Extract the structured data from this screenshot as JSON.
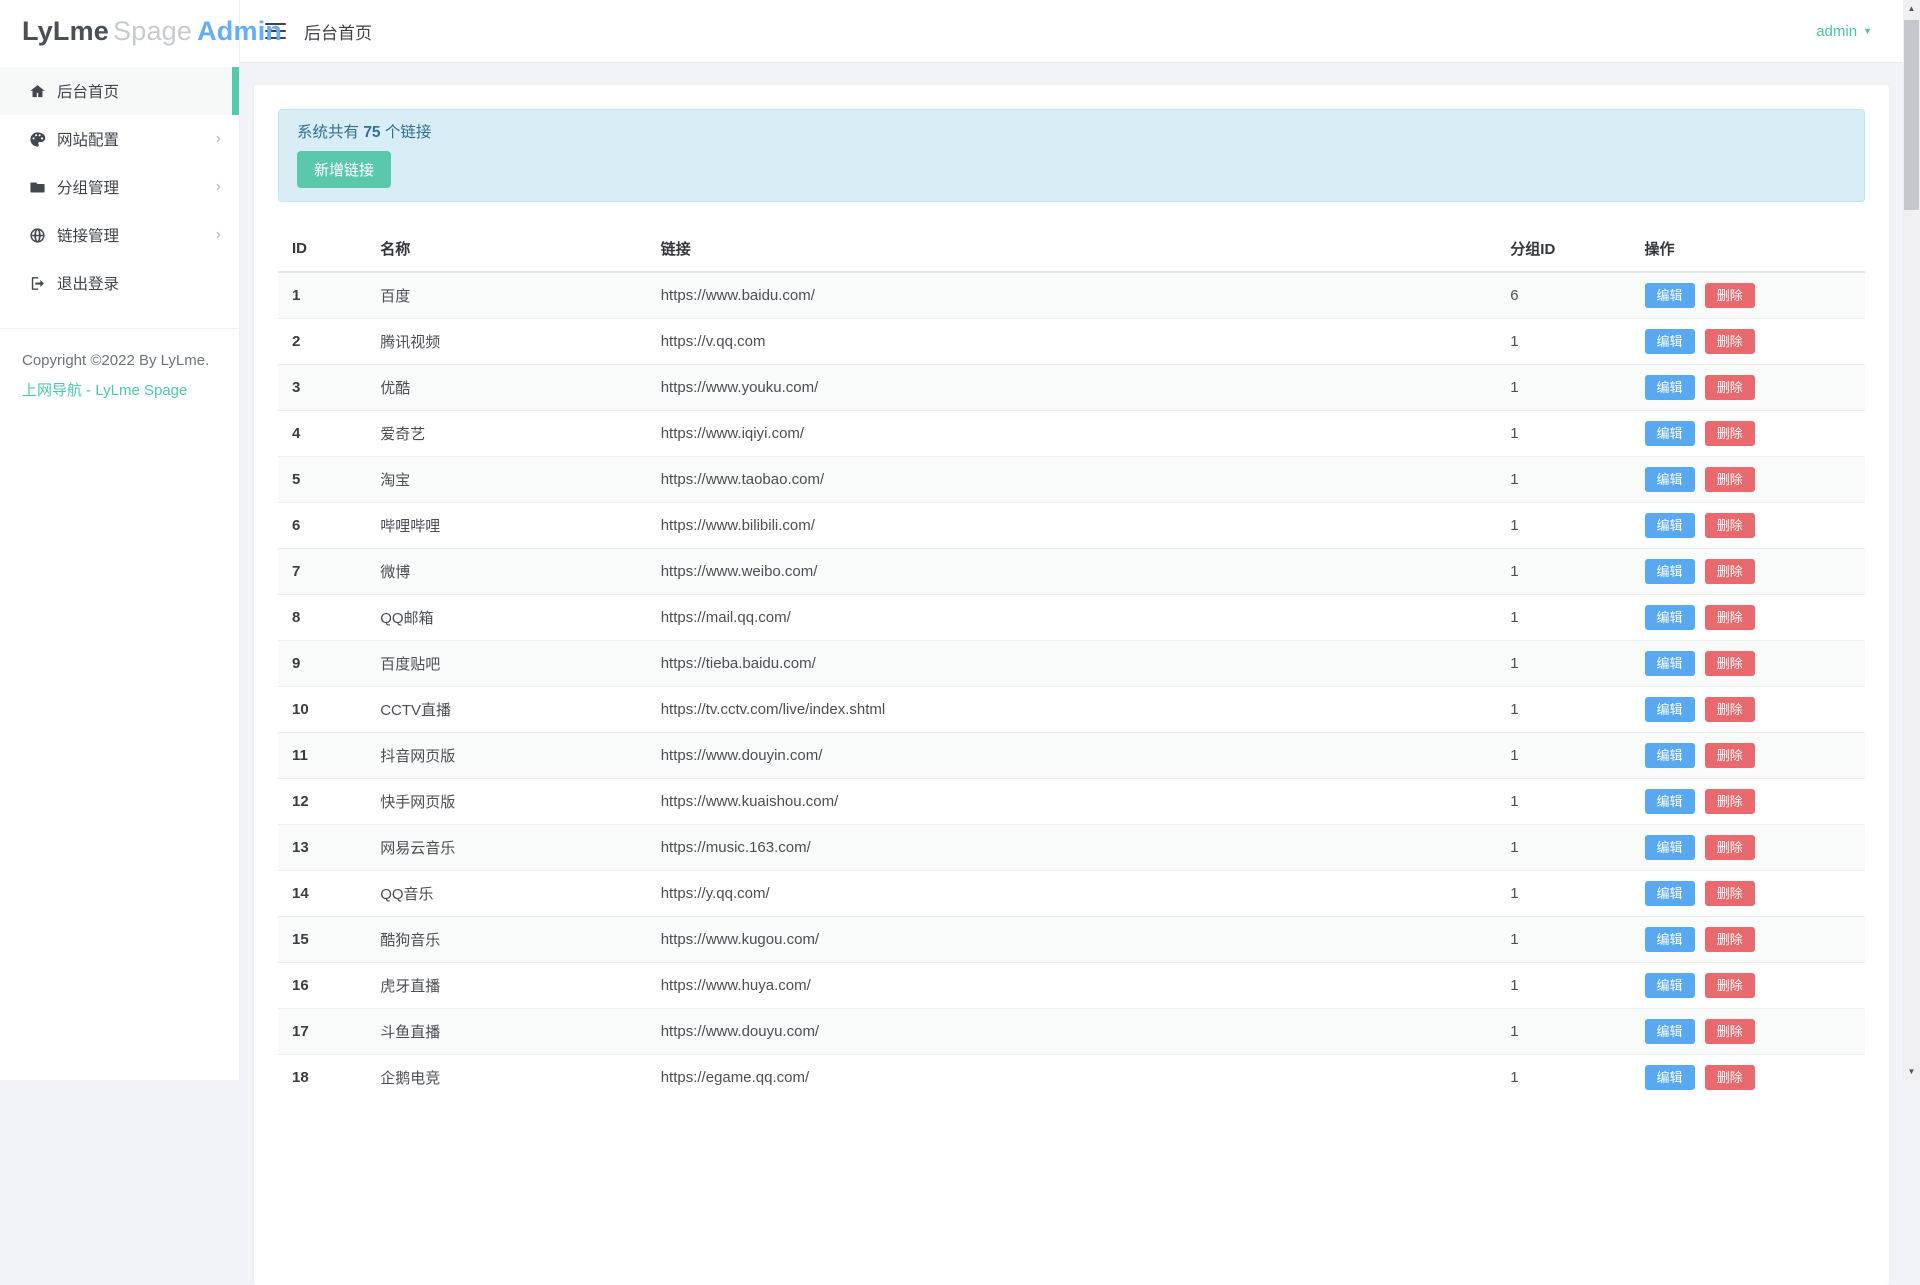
{
  "brand": {
    "part1": "LyLme",
    "part2": "Spage",
    "part3": "Admin"
  },
  "topbar": {
    "title": "后台首页",
    "user": "admin"
  },
  "sidebar": {
    "chevron_glyph": "›",
    "items": [
      {
        "label": "后台首页",
        "icon": "home-icon",
        "active": true
      },
      {
        "label": "网站配置",
        "icon": "palette-icon",
        "expandable": true
      },
      {
        "label": "分组管理",
        "icon": "folder-icon",
        "expandable": true
      },
      {
        "label": "链接管理",
        "icon": "globe-icon",
        "expandable": true
      },
      {
        "label": "退出登录",
        "icon": "logout-icon"
      }
    ],
    "copyright": "Copyright ©2022 By LyLme.",
    "footer_link": "上网导航 - LyLme Spage"
  },
  "alert": {
    "text_prefix": "系统共有 ",
    "count": "75",
    "text_suffix": " 个链接",
    "add_button": "新增链接"
  },
  "table": {
    "headers": {
      "id": "ID",
      "name": "名称",
      "url": "链接",
      "group": "分组ID",
      "ops": "操作"
    },
    "edit_label": "编辑",
    "delete_label": "删除",
    "rows": [
      {
        "id": "1",
        "name": "百度",
        "url": "https://www.baidu.com/",
        "group": "6"
      },
      {
        "id": "2",
        "name": "腾讯视频",
        "url": "https://v.qq.com",
        "group": "1"
      },
      {
        "id": "3",
        "name": "优酷",
        "url": "https://www.youku.com/",
        "group": "1"
      },
      {
        "id": "4",
        "name": "爱奇艺",
        "url": "https://www.iqiyi.com/",
        "group": "1"
      },
      {
        "id": "5",
        "name": "淘宝",
        "url": "https://www.taobao.com/",
        "group": "1"
      },
      {
        "id": "6",
        "name": "哔哩哔哩",
        "url": "https://www.bilibili.com/",
        "group": "1"
      },
      {
        "id": "7",
        "name": "微博",
        "url": "https://www.weibo.com/",
        "group": "1"
      },
      {
        "id": "8",
        "name": "QQ邮箱",
        "url": "https://mail.qq.com/",
        "group": "1"
      },
      {
        "id": "9",
        "name": "百度贴吧",
        "url": "https://tieba.baidu.com/",
        "group": "1"
      },
      {
        "id": "10",
        "name": "CCTV直播",
        "url": "https://tv.cctv.com/live/index.shtml",
        "group": "1"
      },
      {
        "id": "11",
        "name": "抖音网页版",
        "url": "https://www.douyin.com/",
        "group": "1"
      },
      {
        "id": "12",
        "name": "快手网页版",
        "url": "https://www.kuaishou.com/",
        "group": "1"
      },
      {
        "id": "13",
        "name": "网易云音乐",
        "url": "https://music.163.com/",
        "group": "1"
      },
      {
        "id": "14",
        "name": "QQ音乐",
        "url": "https://y.qq.com/",
        "group": "1"
      },
      {
        "id": "15",
        "name": "酷狗音乐",
        "url": "https://www.kugou.com/",
        "group": "1"
      },
      {
        "id": "16",
        "name": "虎牙直播",
        "url": "https://www.huya.com/",
        "group": "1"
      },
      {
        "id": "17",
        "name": "斗鱼直播",
        "url": "https://www.douyu.com/",
        "group": "1"
      },
      {
        "id": "18",
        "name": "企鹅电竞",
        "url": "https://egame.qq.com/",
        "group": "1"
      }
    ]
  },
  "icons": {
    "scroll_up": "▲",
    "scroll_down": "▼",
    "user_caret": "▼"
  },
  "colors": {
    "accent_teal": "#53cbae",
    "link_teal": "#4ec7aa",
    "logo_blue": "#66aef2",
    "edit_blue": "#58a9f0",
    "delete_red": "#e8696e",
    "alert_bg": "#d9edf7",
    "alert_text": "#31708f"
  }
}
